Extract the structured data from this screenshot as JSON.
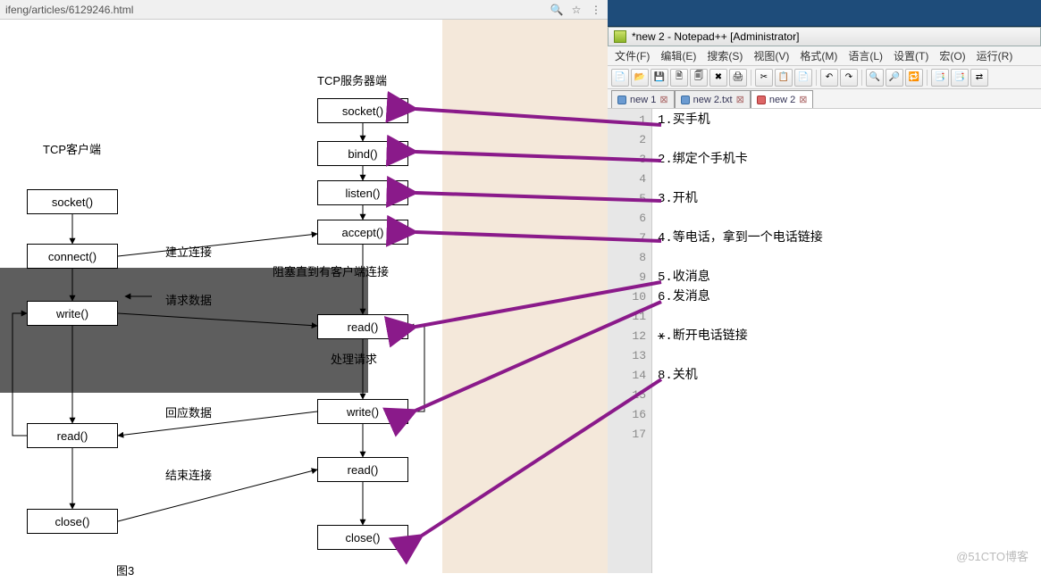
{
  "browser": {
    "url": "ifeng/articles/6129246.html",
    "icons": {
      "zoom": "🔍",
      "star": "☆",
      "menu": "⋮"
    }
  },
  "diagram": {
    "client_title": "TCP客户端",
    "server_title": "TCP服务器端",
    "client_boxes": {
      "socket": "socket()",
      "connect": "connect()",
      "write": "write()",
      "read": "read()",
      "close": "close()"
    },
    "server_boxes": {
      "socket": "socket()",
      "bind": "bind()",
      "listen": "listen()",
      "accept": "accept()",
      "read1": "read()",
      "write": "write()",
      "read2": "read()",
      "close": "close()"
    },
    "labels": {
      "establish": "建立连接",
      "block": "阻塞直到有客户端连接",
      "request": "请求数据",
      "process": "处理请求",
      "response": "回应数据",
      "finish": "结束连接"
    },
    "caption": "图3"
  },
  "npp": {
    "title": "*new 2 - Notepad++ [Administrator]",
    "menus": [
      "文件(F)",
      "编辑(E)",
      "搜索(S)",
      "视图(V)",
      "格式(M)",
      "语言(L)",
      "设置(T)",
      "宏(O)",
      "运行(R)"
    ],
    "tabs": [
      {
        "label": "new 1",
        "dirty": false,
        "active": false,
        "closex": "⊠"
      },
      {
        "label": "new 2.txt",
        "dirty": false,
        "active": false,
        "closex": "⊠"
      },
      {
        "label": "new 2",
        "dirty": true,
        "active": true,
        "closex": "⊠"
      }
    ],
    "toolbar_icons": [
      "📄",
      "📂",
      "💾",
      "🗎",
      "🗐",
      "✖",
      "🖨",
      "|",
      "✂",
      "📋",
      "📄",
      "|",
      "↶",
      "↷",
      "|",
      "🔍",
      "🔎",
      "🔁",
      "|",
      "📑",
      "📑",
      "⇄"
    ],
    "lines": [
      "1.买手机",
      "",
      "2.绑定个手机卡",
      "",
      "3.开机",
      "",
      "4.等电话，拿到一个电话链接",
      "",
      "5.收消息",
      "6.发消息",
      "",
      "⚹.断开电话链接",
      "",
      "8.关机",
      "",
      "",
      ""
    ]
  },
  "watermark": "@51CTO博客",
  "chart_data": {
    "type": "flowchart",
    "title": "TCP Client/Server socket flow",
    "columns": [
      {
        "name": "TCP客户端",
        "nodes": [
          "socket()",
          "connect()",
          "write()",
          "read()",
          "close()"
        ]
      },
      {
        "name": "TCP服务器端",
        "nodes": [
          "socket()",
          "bind()",
          "listen()",
          "accept()",
          "read()",
          "write()",
          "read()",
          "close()"
        ]
      }
    ],
    "cross_edges": [
      {
        "from": "client.connect()",
        "to": "server.accept()",
        "label": "建立连接"
      },
      {
        "from": "client.write()",
        "to": "server.read()",
        "label": "请求数据"
      },
      {
        "from": "server.write()",
        "to": "client.read()",
        "label": "回应数据"
      },
      {
        "from": "client.close()",
        "to": "server.read()",
        "label": "结束连接"
      }
    ],
    "server_notes": [
      {
        "after": "accept()",
        "text": "阻塞直到有客户端连接"
      },
      {
        "after": "read()",
        "text": "处理请求"
      }
    ],
    "annotations_to_notes": [
      {
        "server_node": "socket()",
        "note": "1.买手机"
      },
      {
        "server_node": "bind()",
        "note": "2.绑定个手机卡"
      },
      {
        "server_node": "listen()",
        "note": "3.开机"
      },
      {
        "server_node": "accept()",
        "note": "4.等电话，拿到一个电话链接"
      },
      {
        "server_node": "read()",
        "note": "5.收消息"
      },
      {
        "server_node": "write()",
        "note": "6.发消息"
      },
      {
        "server_node": "close()",
        "note": "8.关机"
      }
    ]
  }
}
